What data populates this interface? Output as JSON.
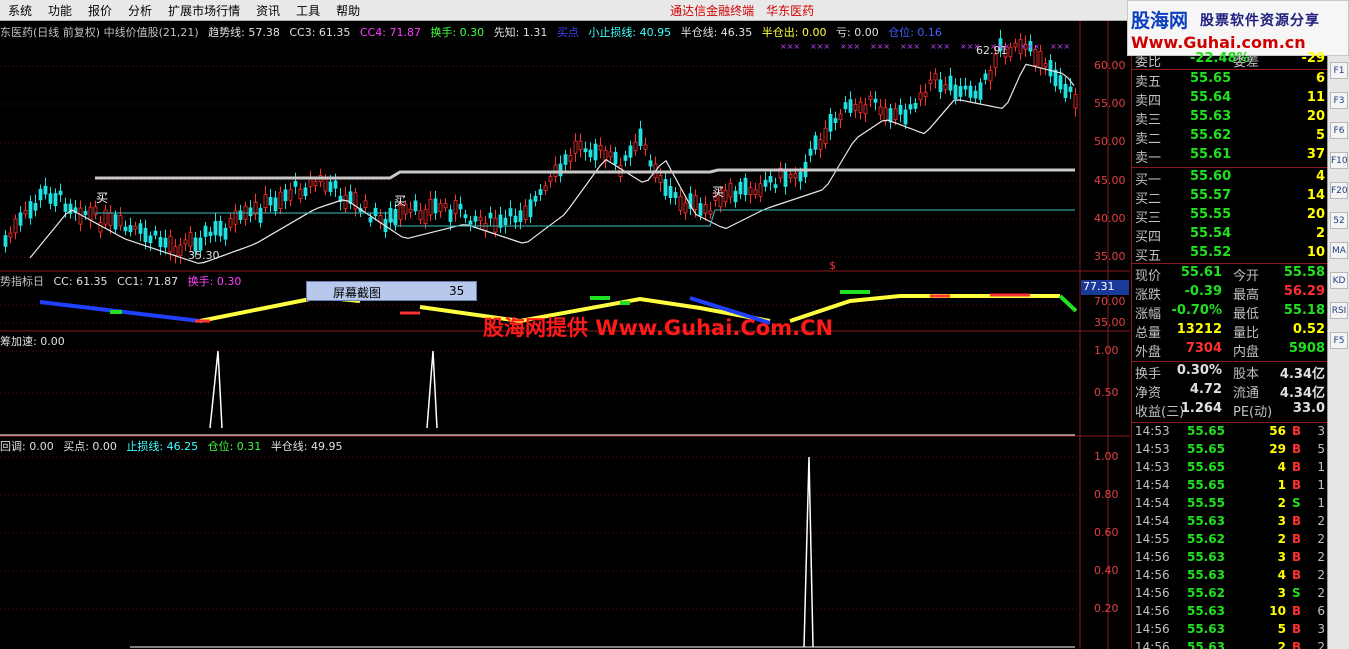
{
  "menu": {
    "items": [
      "系统",
      "功能",
      "报价",
      "分析",
      "扩展市场行情",
      "资讯",
      "工具",
      "帮助"
    ],
    "link1": "通达信金融终端",
    "link2": "华东医药"
  },
  "logo": {
    "main": "股海网",
    "side": "股票软件资源分享",
    "url": "Www.Guhai.com.cn"
  },
  "panel1": {
    "header": [
      "东医药(日线 前复权) 中线价值股(21,21)",
      "趋势线: 57.38",
      "CC3: 61.35",
      "CC4: 71.87",
      "换手: 0.30",
      "先知: 1.31",
      "买点",
      "小止损线: 40.95",
      "半仓线: 46.35",
      "半仓出: 0.00",
      "亏: 0.00",
      "仓位: 0.16"
    ],
    "y_labels": [
      "60.00",
      "55.00",
      "50.00",
      "45.00",
      "40.00",
      "35.00"
    ],
    "annotations": {
      "high": "62.91",
      "low": "35.30",
      "buy1": "买",
      "buy2": "买",
      "buy3": "买",
      "dollar": "$"
    }
  },
  "panel2": {
    "header": [
      "势指标日",
      "CC: 61.35",
      "CC1: 71.87",
      "换手: 0.30"
    ],
    "y_labels": [
      "77.31",
      "70.00",
      "35.00"
    ]
  },
  "panel3": {
    "header": [
      "筹加速: 0.00"
    ],
    "y_labels": [
      "1.00",
      "0.50"
    ]
  },
  "panel4": {
    "header": [
      "回调: 0.00",
      "买点: 0.00",
      "止损线: 46.25",
      "仓位: 0.31",
      "半仓线: 49.95"
    ],
    "y_labels": [
      "1.00",
      "0.80",
      "0.60",
      "0.40",
      "0.20"
    ]
  },
  "popup": {
    "label": "屏幕截图",
    "value": "35"
  },
  "watermark": "股海网提供 Www.Guhai.Com.CN",
  "quote": {
    "weibi": {
      "label": "委比",
      "value": "-22.48%",
      "label2": "委差",
      "value2": "-29"
    },
    "asks": [
      {
        "label": "卖五",
        "price": "55.65",
        "vol": "6"
      },
      {
        "label": "卖四",
        "price": "55.64",
        "vol": "11"
      },
      {
        "label": "卖三",
        "price": "55.63",
        "vol": "20"
      },
      {
        "label": "卖二",
        "price": "55.62",
        "vol": "5"
      },
      {
        "label": "卖一",
        "price": "55.61",
        "vol": "37"
      }
    ],
    "bids": [
      {
        "label": "买一",
        "price": "55.60",
        "vol": "4"
      },
      {
        "label": "买二",
        "price": "55.57",
        "vol": "14"
      },
      {
        "label": "买三",
        "price": "55.55",
        "vol": "20"
      },
      {
        "label": "买四",
        "price": "55.54",
        "vol": "2"
      },
      {
        "label": "买五",
        "price": "55.52",
        "vol": "10"
      }
    ],
    "stats": [
      {
        "l1": "现价",
        "v1": "55.61",
        "c1": "#20e020",
        "l2": "今开",
        "v2": "55.58",
        "c2": "#20e020"
      },
      {
        "l1": "涨跌",
        "v1": "-0.39",
        "c1": "#20e020",
        "l2": "最高",
        "v2": "56.29",
        "c2": "#ff3030"
      },
      {
        "l1": "涨幅",
        "v1": "-0.70%",
        "c1": "#20e020",
        "l2": "最低",
        "v2": "55.18",
        "c2": "#20e020"
      },
      {
        "l1": "总量",
        "v1": "13212",
        "c1": "#ffff00",
        "l2": "量比",
        "v2": "0.52",
        "c2": "#ffff00"
      },
      {
        "l1": "外盘",
        "v1": "7304",
        "c1": "#ff3030",
        "l2": "内盘",
        "v2": "5908",
        "c2": "#20e020"
      }
    ],
    "stats2": [
      {
        "l1": "换手",
        "v1": "0.30%",
        "c1": "#e0e0e0",
        "l2": "股本",
        "v2": "4.34亿",
        "c2": "#e0e0e0"
      },
      {
        "l1": "净资",
        "v1": "4.72",
        "c1": "#e0e0e0",
        "l2": "流通",
        "v2": "4.34亿",
        "c2": "#e0e0e0"
      },
      {
        "l1": "收益(三)",
        "v1": "1.264",
        "c1": "#e0e0e0",
        "l2": "PE(动)",
        "v2": "33.0",
        "c2": "#e0e0e0"
      }
    ],
    "ticks": [
      {
        "time": "14:53",
        "price": "55.65",
        "vol": "56",
        "bs": "B",
        "n": "3"
      },
      {
        "time": "14:53",
        "price": "55.65",
        "vol": "29",
        "bs": "B",
        "n": "5"
      },
      {
        "time": "14:53",
        "price": "55.65",
        "vol": "4",
        "bs": "B",
        "n": "1"
      },
      {
        "time": "14:54",
        "price": "55.65",
        "vol": "1",
        "bs": "B",
        "n": "1"
      },
      {
        "time": "14:54",
        "price": "55.55",
        "vol": "2",
        "bs": "S",
        "n": "1"
      },
      {
        "time": "14:54",
        "price": "55.63",
        "vol": "3",
        "bs": "B",
        "n": "2"
      },
      {
        "time": "14:55",
        "price": "55.62",
        "vol": "2",
        "bs": "B",
        "n": "2"
      },
      {
        "time": "14:56",
        "price": "55.63",
        "vol": "3",
        "bs": "B",
        "n": "2"
      },
      {
        "time": "14:56",
        "price": "55.63",
        "vol": "4",
        "bs": "B",
        "n": "2"
      },
      {
        "time": "14:56",
        "price": "55.62",
        "vol": "3",
        "bs": "S",
        "n": "2"
      },
      {
        "time": "14:56",
        "price": "55.63",
        "vol": "10",
        "bs": "B",
        "n": "6"
      },
      {
        "time": "14:56",
        "price": "55.63",
        "vol": "5",
        "bs": "B",
        "n": "3"
      },
      {
        "time": "14:56",
        "price": "55.63",
        "vol": "2",
        "bs": "B",
        "n": "2"
      }
    ]
  },
  "toolbar": [
    "F1",
    "F3",
    "F6",
    "F10",
    "F20",
    "52",
    "MA",
    "KD",
    "RSI",
    "F5"
  ],
  "colors": {
    "up": "#ff3030",
    "down": "#20e020",
    "panel_border": "#8a1a1a"
  }
}
